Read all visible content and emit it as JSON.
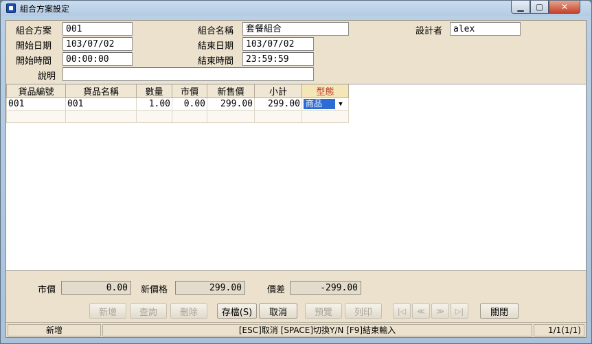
{
  "window": {
    "title": "組合方案設定",
    "minimize_icon": "minimize-icon",
    "maximize_icon": "maximize-icon",
    "close_icon": "close-icon"
  },
  "form": {
    "plan_label": "組合方案",
    "plan_value": "001",
    "name_label": "組合名稱",
    "name_value": "套餐組合",
    "designer_label": "設計者",
    "designer_value": "alex",
    "start_date_label": "開始日期",
    "start_date_value": "103/07/02",
    "end_date_label": "結束日期",
    "end_date_value": "103/07/02",
    "start_time_label": "開始時間",
    "start_time_value": "00:00:00",
    "end_time_label": "結束時間",
    "end_time_value": "23:59:59",
    "desc_label": "說明",
    "desc_value": ""
  },
  "grid": {
    "columns": [
      "貨品編號",
      "貨品名稱",
      "數量",
      "市價",
      "新售價",
      "小計",
      "型態"
    ],
    "rows": [
      {
        "code": "001",
        "name": "001",
        "qty": "1.00",
        "market": "0.00",
        "new_price": "299.00",
        "subtotal": "299.00",
        "type": "商品"
      }
    ]
  },
  "totals": {
    "market_label": "市價",
    "market_value": "0.00",
    "new_price_label": "新價格",
    "new_price_value": "299.00",
    "diff_label": "價差",
    "diff_value": "-299.00"
  },
  "buttons": {
    "add": "新增",
    "query": "查詢",
    "delete": "刪除",
    "save": "存檔(S)",
    "cancel": "取消",
    "preview": "預覽",
    "print": "列印",
    "first": "|◁",
    "prev": "≪",
    "next": "≫",
    "last": "▷|",
    "close": "關閉"
  },
  "status": {
    "mode": "新增",
    "hint": "[ESC]取消 [SPACE]切換Y/N [F9]結束輸入",
    "page": "1/1(1/1)"
  }
}
